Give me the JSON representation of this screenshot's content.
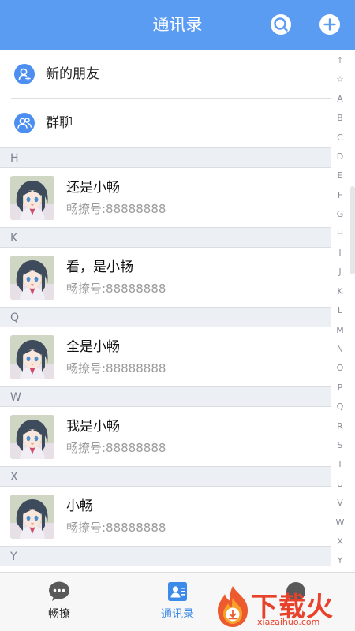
{
  "header": {
    "title": "通讯录",
    "search_icon": "search-icon",
    "add_icon": "add-icon",
    "color": "#5b9cf3"
  },
  "top_items": [
    {
      "label": "新的朋友",
      "icon": "add-friend-icon"
    },
    {
      "label": "群聊",
      "icon": "group-chat-icon"
    }
  ],
  "sections": [
    {
      "letter": "H",
      "contacts": [
        {
          "name": "还是小畅",
          "id": "畅撩号:88888888"
        }
      ]
    },
    {
      "letter": "K",
      "contacts": [
        {
          "name": "看，是小畅",
          "id": "畅撩号:88888888"
        }
      ]
    },
    {
      "letter": "Q",
      "contacts": [
        {
          "name": "全是小畅",
          "id": "畅撩号:88888888"
        }
      ]
    },
    {
      "letter": "W",
      "contacts": [
        {
          "name": "我是小畅",
          "id": "畅撩号:88888888"
        }
      ]
    },
    {
      "letter": "X",
      "contacts": [
        {
          "name": "小畅",
          "id": "畅撩号:88888888"
        }
      ]
    },
    {
      "letter": "Y",
      "contacts": []
    }
  ],
  "index_letters": [
    "↑",
    "☆",
    "A",
    "B",
    "C",
    "D",
    "E",
    "F",
    "G",
    "H",
    "I",
    "J",
    "K",
    "L",
    "M",
    "N",
    "O",
    "P",
    "Q",
    "R",
    "S",
    "T",
    "U",
    "V",
    "W",
    "X",
    "Y"
  ],
  "tabbar": {
    "tabs": [
      {
        "label": "畅撩",
        "icon": "chat-bubble-icon",
        "active": false
      },
      {
        "label": "通讯录",
        "icon": "contacts-icon",
        "active": true
      },
      {
        "label": "",
        "icon": "profile-icon",
        "active": false
      }
    ],
    "active_color": "#3d8be8",
    "inactive_color": "#222222"
  },
  "watermark": {
    "text": "下载火",
    "url": "xiazaihuo.com"
  }
}
